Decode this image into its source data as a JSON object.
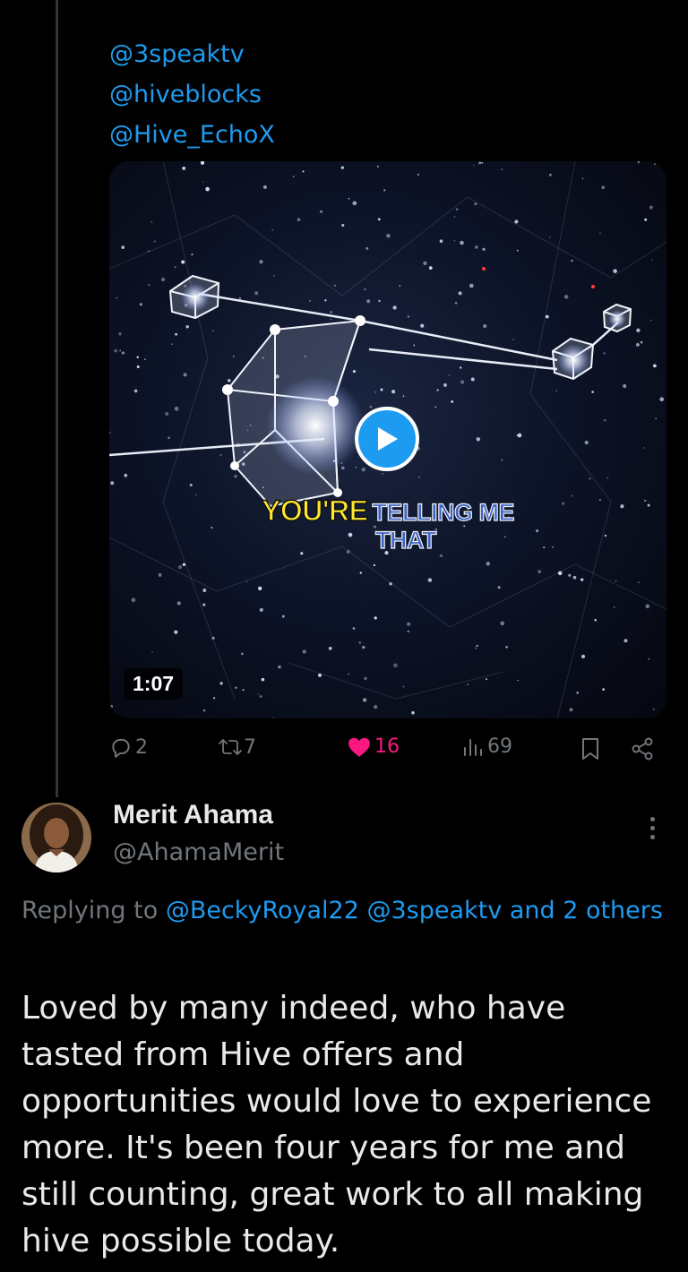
{
  "mentions": [
    "@3speaktv",
    "@hiveblocks",
    "@Hive_EchoX"
  ],
  "video": {
    "caption_part1": "YOU'RE",
    "caption_part2": "TELLING ME",
    "caption_part3": "THAT",
    "duration": "1:07"
  },
  "actions": {
    "replies": "2",
    "reposts": "7",
    "likes": "16",
    "views": "69"
  },
  "reply": {
    "author_name": "Merit Ahama",
    "author_handle": "@AhamaMerit",
    "replying_to_prefix": "Replying to",
    "replying_to_users": "@BeckyRoyal22 @3speaktv",
    "replying_to_others": "and 2 others",
    "text": "Loved by many indeed, who have tasted from Hive offers and opportunities would love to experience more. It's been four years for me and still counting, great work to all making hive possible today."
  },
  "colors": {
    "accent": "#1d9bf0",
    "like": "#f91880",
    "muted": "#71767b",
    "text": "#e7e9ea",
    "background": "#000000"
  }
}
